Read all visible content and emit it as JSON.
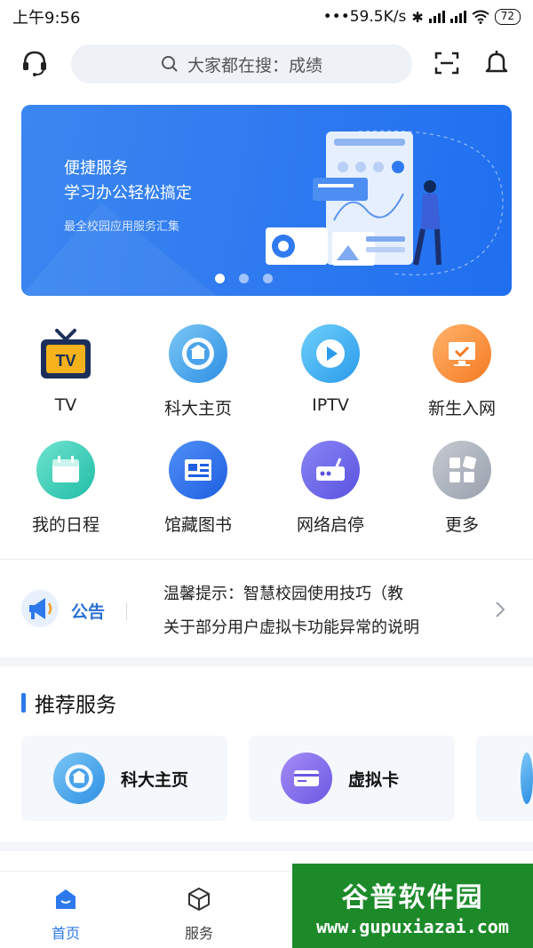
{
  "status_bar": {
    "time": "上午9:56",
    "network_speed": "•••59.5K/s",
    "battery": "72"
  },
  "header": {
    "search_placeholder": "大家都在搜：成绩"
  },
  "banner": {
    "title_line1": "便捷服务",
    "title_line2": "学习办公轻松搞定",
    "subtitle": "最全校园应用服务汇集",
    "dots": 3,
    "active_dot": 0
  },
  "apps": [
    {
      "label": "TV",
      "icon": "tv-icon"
    },
    {
      "label": "科大主页",
      "icon": "school-logo-icon"
    },
    {
      "label": "IPTV",
      "icon": "play-icon"
    },
    {
      "label": "新生入网",
      "icon": "monitor-check-icon"
    },
    {
      "label": "我的日程",
      "icon": "calendar-icon"
    },
    {
      "label": "馆藏图书",
      "icon": "library-card-icon"
    },
    {
      "label": "网络启停",
      "icon": "router-icon"
    },
    {
      "label": "更多",
      "icon": "more-grid-icon"
    }
  ],
  "notice": {
    "label": "公告",
    "items": [
      "温馨提示：智慧校园使用技巧（教",
      "关于部分用户虚拟卡功能异常的说明"
    ]
  },
  "recommended": {
    "title": "推荐服务",
    "cards": [
      {
        "label": "科大主页",
        "icon": "school-logo-icon"
      },
      {
        "label": "虚拟卡",
        "icon": "card-icon"
      }
    ]
  },
  "bottom_nav": [
    {
      "label": "首页",
      "icon": "home-icon",
      "active": true
    },
    {
      "label": "服务",
      "icon": "cube-icon",
      "active": false
    }
  ],
  "watermark": {
    "main": "谷普软件园",
    "url": "www.gupuxiazai.com"
  },
  "colors": {
    "accent": "#2d79ec",
    "banner": "#2f7af0",
    "watermark": "#1d8a2a"
  }
}
